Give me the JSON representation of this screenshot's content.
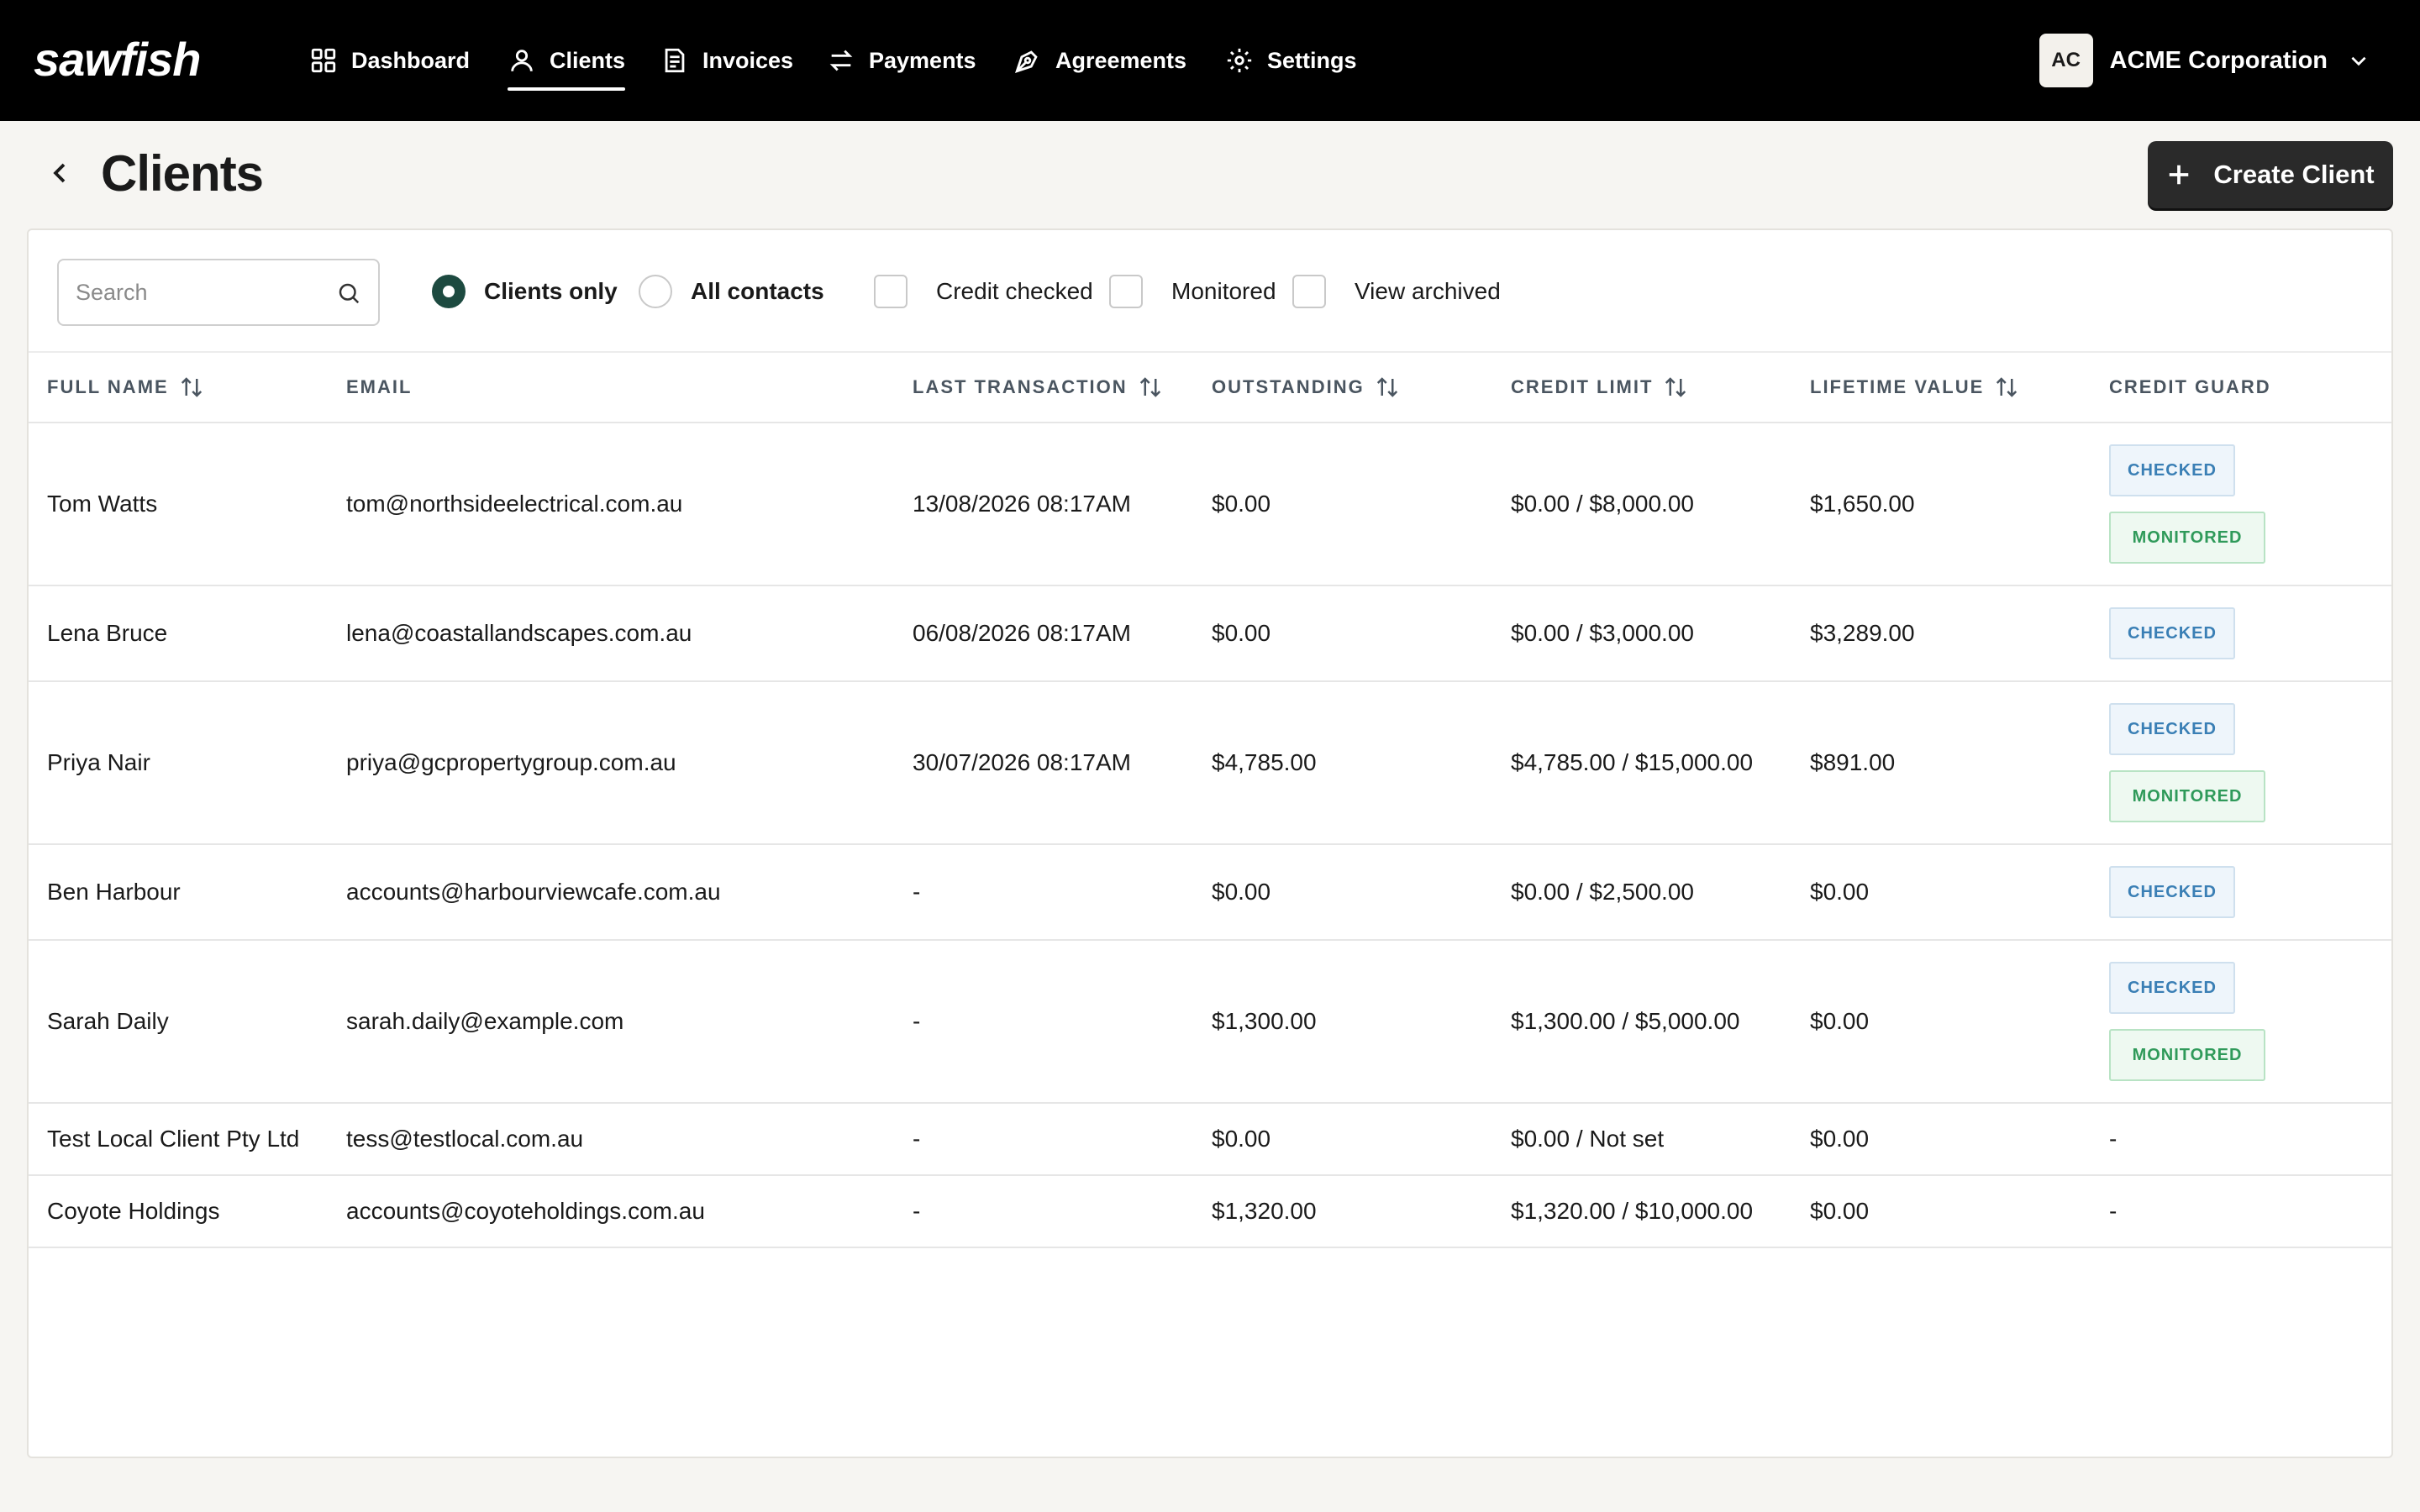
{
  "brand": {
    "logo_text": "sawfish"
  },
  "nav": {
    "items": [
      {
        "label": "Dashboard",
        "icon": "grid-icon"
      },
      {
        "label": "Clients",
        "icon": "user-icon",
        "active": true
      },
      {
        "label": "Invoices",
        "icon": "invoice-icon"
      },
      {
        "label": "Payments",
        "icon": "transfer-arrows-icon"
      },
      {
        "label": "Agreements",
        "icon": "pen-nib-icon"
      },
      {
        "label": "Settings",
        "icon": "gear-icon"
      }
    ]
  },
  "org": {
    "initials": "AC",
    "name": "ACME Corporation"
  },
  "page": {
    "title": "Clients",
    "create_label": "Create Client"
  },
  "filters": {
    "search_placeholder": "Search",
    "clients_only": "Clients only",
    "all_contacts": "All contacts",
    "credit_checked": "Credit checked",
    "monitored": "Monitored",
    "view_archived": "View archived"
  },
  "table": {
    "columns": {
      "full_name": "FULL NAME",
      "email": "EMAIL",
      "last_transaction": "LAST TRANSACTION",
      "outstanding": "OUTSTANDING",
      "credit_limit": "CREDIT LIMIT",
      "lifetime_value": "LIFETIME VALUE",
      "credit_guard": "CREDIT GUARD"
    },
    "badges": {
      "checked": "CHECKED",
      "monitored": "MONITORED"
    },
    "rows": [
      {
        "name": "Tom Watts",
        "email": "tom@northsideelectrical.com.au",
        "last": "13/08/2026 08:17AM",
        "outstanding": "$0.00",
        "credit": "$0.00 / $8,000.00",
        "lifetime": "$1,650.00",
        "guard": ""
      },
      {
        "name": "Lena Bruce",
        "email": "lena@coastallandscapes.com.au",
        "last": "06/08/2026 08:17AM",
        "outstanding": "$0.00",
        "credit": "$0.00 / $3,000.00",
        "lifetime": "$3,289.00",
        "guard": ""
      },
      {
        "name": "Priya Nair",
        "email": "priya@gcpropertygroup.com.au",
        "last": "30/07/2026 08:17AM",
        "outstanding": "$4,785.00",
        "credit": "$4,785.00 / $15,000.00",
        "lifetime": "$891.00",
        "guard": ""
      },
      {
        "name": "Ben Harbour",
        "email": "accounts@harbourviewcafe.com.au",
        "last": "-",
        "outstanding": "$0.00",
        "credit": "$0.00 / $2,500.00",
        "lifetime": "$0.00",
        "guard": ""
      },
      {
        "name": "Sarah Daily",
        "email": "sarah.daily@example.com",
        "last": "-",
        "outstanding": "$1,300.00",
        "credit": "$1,300.00 / $5,000.00",
        "lifetime": "$0.00",
        "guard": ""
      },
      {
        "name": "Test Local Client Pty Ltd",
        "email": "tess@testlocal.com.au",
        "last": "-",
        "outstanding": "$0.00",
        "credit": "$0.00 / Not set",
        "lifetime": "$0.00",
        "guard": "-"
      },
      {
        "name": "Coyote Holdings",
        "email": "accounts@coyoteholdings.com.au",
        "last": "-",
        "outstanding": "$1,320.00",
        "credit": "$1,320.00 / $10,000.00",
        "lifetime": "$0.00",
        "guard": "-"
      }
    ]
  }
}
